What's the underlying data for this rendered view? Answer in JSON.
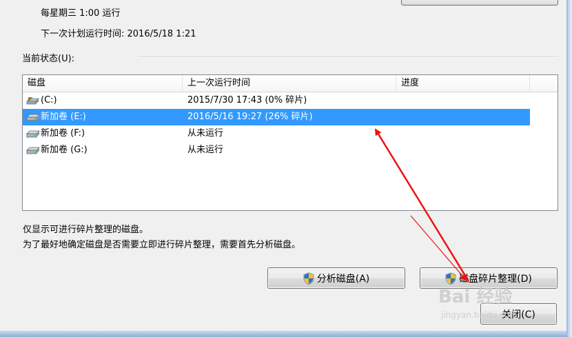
{
  "schedule": {
    "frequency": "每星期三  1:00 运行",
    "next_run": "下一次计划运行时间: 2016/5/18 1:21"
  },
  "current_status_label": "当前状态(U):",
  "table": {
    "headers": [
      "磁盘",
      "上一次运行时间",
      "进度"
    ],
    "rows": [
      {
        "name": "(C:)",
        "last_run": "2015/7/30 17:43 (0% 碎片)",
        "icon": "system-drive-icon"
      },
      {
        "name": "新加卷 (E:)",
        "last_run": "2016/5/16 19:27 (26% 碎片)",
        "icon": "drive-icon",
        "selected": true
      },
      {
        "name": "新加卷 (F:)",
        "last_run": "从未运行",
        "icon": "drive-icon"
      },
      {
        "name": "新加卷 (G:)",
        "last_run": "从未运行",
        "icon": "drive-icon"
      }
    ]
  },
  "notes": {
    "line1": "仅显示可进行碎片整理的磁盘。",
    "line2": "为了最好地确定磁盘是否需要立即进行碎片整理，需要首先分析磁盘。"
  },
  "buttons": {
    "analyze": "分析磁盘(A)",
    "defragment": "磁盘碎片整理(D)",
    "close": "关闭(C)"
  },
  "watermark": {
    "main": "Bai 经验",
    "sub": "jingyan.baidu.com"
  },
  "colors": {
    "selection": "#3399ff",
    "annotation_arrow": "#ee1111"
  }
}
